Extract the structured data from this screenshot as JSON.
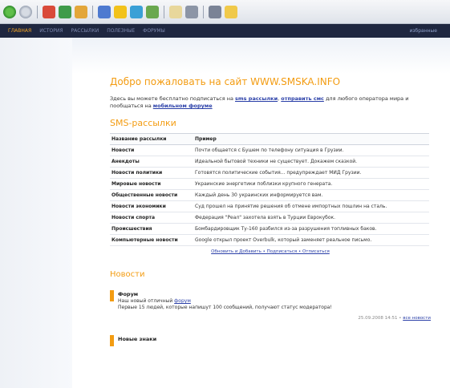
{
  "toolbar": {
    "icons": [
      "back-icon",
      "forward-icon",
      "stop-icon",
      "refresh-icon",
      "home-icon",
      "search-icon",
      "favorites-icon",
      "media-icon",
      "history-icon",
      "mail-icon",
      "print-icon",
      "edit-icon",
      "folder-icon"
    ]
  },
  "nav": {
    "items": [
      "ГЛАВНАЯ",
      "ИСТОРИЯ",
      "РАССЫЛКИ",
      "ПОЛЕЗНЫЕ",
      "ФОРУМЫ"
    ],
    "right": "избранные"
  },
  "page": {
    "title": "Добро пожаловать на сайт WWW.SMSKA.INFO",
    "intro_start": "Здесь вы можете бесплатно подписаться на ",
    "intro_link1": "sms рассылки",
    "intro_mid": ", ",
    "intro_link2": "отправить смс",
    "intro_rest": " для любого оператора мира и пообщаться на ",
    "intro_link3": "мобильном форуме",
    "section_title": "SMS-рассылки",
    "news_title": "Новости"
  },
  "table": {
    "headers": [
      "Название рассылки",
      "Пример"
    ],
    "rows": [
      [
        "Новости",
        "Почти общается с Бушем по телефону ситуация в Грузии."
      ],
      [
        "Анекдоты",
        "Идеальной бытовой техники не существует. Докажем сказкой."
      ],
      [
        "Новости политики",
        "Готовятся политические события... предупреждает МИД Грузии."
      ],
      [
        "Мировые новости",
        "Украинские энергетики поблизки крупного генерата."
      ],
      [
        "Общественные новости",
        "Каждый день 30 украинских информируется вам."
      ],
      [
        "Новости экономики",
        "Суд прошел на принятие решения об отмене импортных пошлин на сталь."
      ],
      [
        "Новости спорта",
        "Федерация \"Реал\" захотела взять в Турции Еврокубок."
      ],
      [
        "Происшествия",
        "Бомбардировщик Ту-160 разбился из-за разрушения топливных баков."
      ],
      [
        "Компьютерные новости",
        "Google открыл проект Overbulk, который заменяет реальное письмо."
      ]
    ],
    "links": "Обновить и Добавить • Подписаться • Отписаться"
  },
  "news": [
    {
      "title": "Форум",
      "text_pre": "Наш новый отличный ",
      "text_link": "форум",
      "text_post": "Первые 15 людей, которые напишут 100 сообщений, получают статус модератора!",
      "meta_date": "25.09.2008 14:51 •",
      "meta_link": "все новости"
    },
    {
      "title": "Новые знаки",
      "text_pre": "",
      "text_link": "",
      "text_post": "",
      "meta_date": "",
      "meta_link": ""
    }
  ],
  "colors": {
    "accent": "#f39c12",
    "nav_bg": "#1f2740",
    "link": "#2a3fa8"
  }
}
